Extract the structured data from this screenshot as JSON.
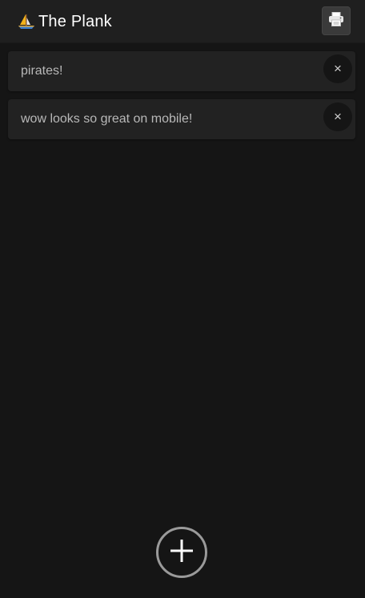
{
  "header": {
    "title": "The Plank",
    "logo_icon": "sailboat-icon",
    "print_icon": "printer-icon"
  },
  "notes": [
    {
      "text": "pirates!",
      "close_label": "×"
    },
    {
      "text": "wow looks so great on mobile!",
      "close_label": "×"
    }
  ],
  "add_button": {
    "icon": "plus-icon"
  },
  "colors": {
    "background": "#151515",
    "header": "#1f1f1f",
    "card": "#222222",
    "text": "#b8b8b8",
    "title": "#ffffff"
  }
}
